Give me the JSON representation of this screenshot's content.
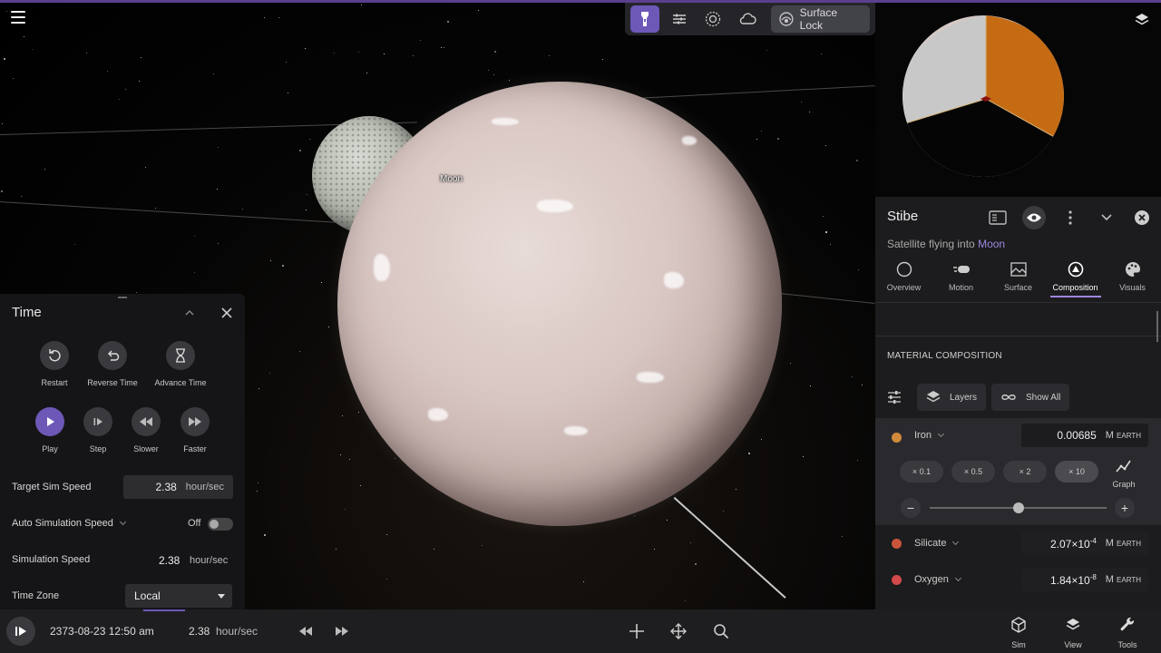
{
  "moon_label": "Moon",
  "toolbar": {
    "surface_lock_label": "Surface Lock",
    "icons": [
      "flashlight-icon",
      "filter-sliders-icon",
      "gravity-icon",
      "cloud-icon",
      "surface-lock-icon"
    ]
  },
  "time_panel": {
    "title": "Time",
    "controls_row1": [
      {
        "label": "Restart",
        "icon": "restart-icon"
      },
      {
        "label": "Reverse Time",
        "icon": "reverse-time-icon"
      },
      {
        "label": "Advance Time",
        "icon": "hourglass-icon"
      }
    ],
    "controls_row2": [
      {
        "label": "Play",
        "icon": "play-icon"
      },
      {
        "label": "Step",
        "icon": "step-icon"
      },
      {
        "label": "Slower",
        "icon": "rewind-icon"
      },
      {
        "label": "Faster",
        "icon": "fast-forward-icon"
      }
    ],
    "target_sim_speed_label": "Target Sim Speed",
    "target_sim_speed_value": "2.38",
    "target_sim_speed_unit": "hour/sec",
    "auto_sim_speed_label": "Auto Simulation Speed",
    "auto_sim_speed_state": "Off",
    "sim_speed_label": "Simulation Speed",
    "sim_speed_value": "2.38",
    "sim_speed_unit": "hour/sec",
    "time_zone_label": "Time Zone",
    "time_zone_value": "Local"
  },
  "details": {
    "title": "Stibe",
    "subtitle_prefix": "Satellite flying into",
    "subtitle_link": "Moon",
    "tabs": [
      {
        "label": "Overview",
        "icon": "circle-icon"
      },
      {
        "label": "Motion",
        "icon": "motion-icon"
      },
      {
        "label": "Surface",
        "icon": "surface-icon"
      },
      {
        "label": "Composition",
        "icon": "composition-icon"
      },
      {
        "label": "Visuals",
        "icon": "palette-icon"
      }
    ],
    "active_tab": "Composition",
    "section_title": "MATERIAL COMPOSITION",
    "layers_label": "Layers",
    "show_all_label": "Show All",
    "materials": [
      {
        "name": "Iron",
        "value": "0.00685",
        "unit": "M",
        "unit_sub": "EARTH",
        "color": "#d08a3a"
      },
      {
        "name": "Silicate",
        "value_mantissa": "2.07",
        "value_exp": "-4",
        "unit": "M",
        "unit_sub": "EARTH",
        "color": "#c8553a"
      },
      {
        "name": "Oxygen",
        "value_mantissa": "1.84",
        "value_exp": "-8",
        "unit": "M",
        "unit_sub": "EARTH",
        "color": "#d24a4a"
      }
    ],
    "multipliers": [
      "× 0.1",
      "× 0.5",
      "× 2",
      "× 10"
    ],
    "graph_label": "Graph",
    "iron_slider_fraction": 0.5
  },
  "bottom": {
    "datetime": "2373-08-23 12:50 am",
    "speed_value": "2.38",
    "speed_unit": "hour/sec",
    "nav": [
      {
        "label": "Sim",
        "icon": "cube-icon"
      },
      {
        "label": "View",
        "icon": "layers-icon"
      },
      {
        "label": "Tools",
        "icon": "wrench-icon"
      }
    ]
  },
  "colors": {
    "accent": "#6d58b8",
    "link": "#9f86e0"
  }
}
